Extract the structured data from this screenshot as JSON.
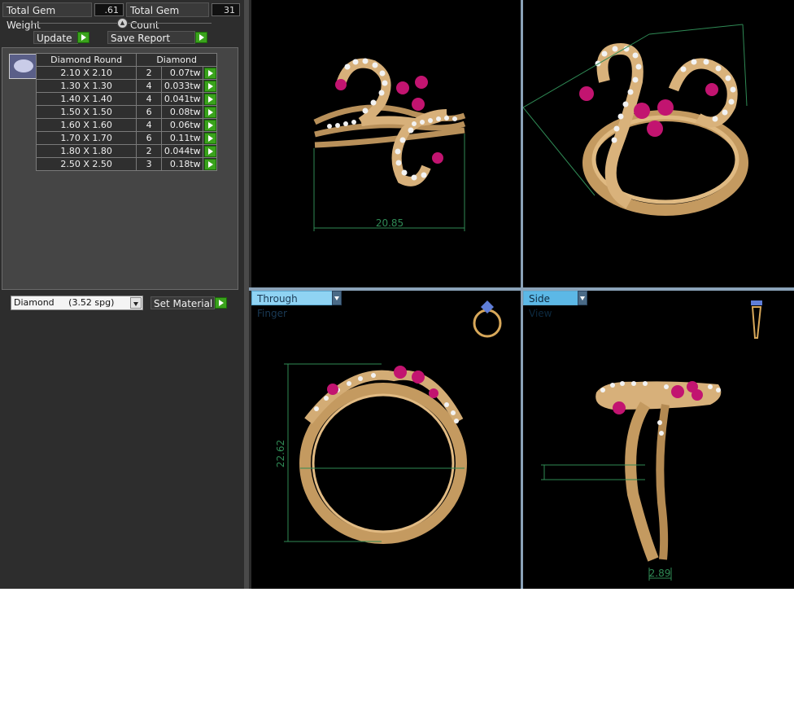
{
  "summary": {
    "weight_label": "Total Gem Weight",
    "weight_value": ".61",
    "count_label": "Total Gem Count",
    "count_value": "31"
  },
  "actions": {
    "update": "Update",
    "save_report": "Save Report"
  },
  "gem_table": {
    "headers": [
      "Diamond Round",
      "Diamond"
    ],
    "rows": [
      {
        "size": "2.10 X 2.10",
        "count": "2",
        "weight": "0.07tw"
      },
      {
        "size": "1.30 X 1.30",
        "count": "4",
        "weight": "0.033tw"
      },
      {
        "size": "1.40 X 1.40",
        "count": "4",
        "weight": "0.041tw"
      },
      {
        "size": "1.50 X 1.50",
        "count": "6",
        "weight": "0.08tw"
      },
      {
        "size": "1.60 X 1.60",
        "count": "4",
        "weight": "0.06tw"
      },
      {
        "size": "1.70 X 1.70",
        "count": "6",
        "weight": "0.11tw"
      },
      {
        "size": "1.80 X 1.80",
        "count": "2",
        "weight": "0.044tw"
      },
      {
        "size": "2.50 X 2.50",
        "count": "3",
        "weight": "0.18tw"
      }
    ]
  },
  "material": {
    "selected": "Diamond     (3.52 spg)",
    "set_label": "Set Material"
  },
  "views": {
    "through_finger": "Through Finger",
    "side_view": "Side View"
  },
  "dimensions": {
    "top_width": "20.85",
    "finger_height": "22.62",
    "side_depth": "2.89"
  },
  "colors": {
    "gold": "#c9a26b",
    "ruby": "#c21470",
    "dim_line": "#2f8a55",
    "view_label": "#8fd3f3"
  }
}
